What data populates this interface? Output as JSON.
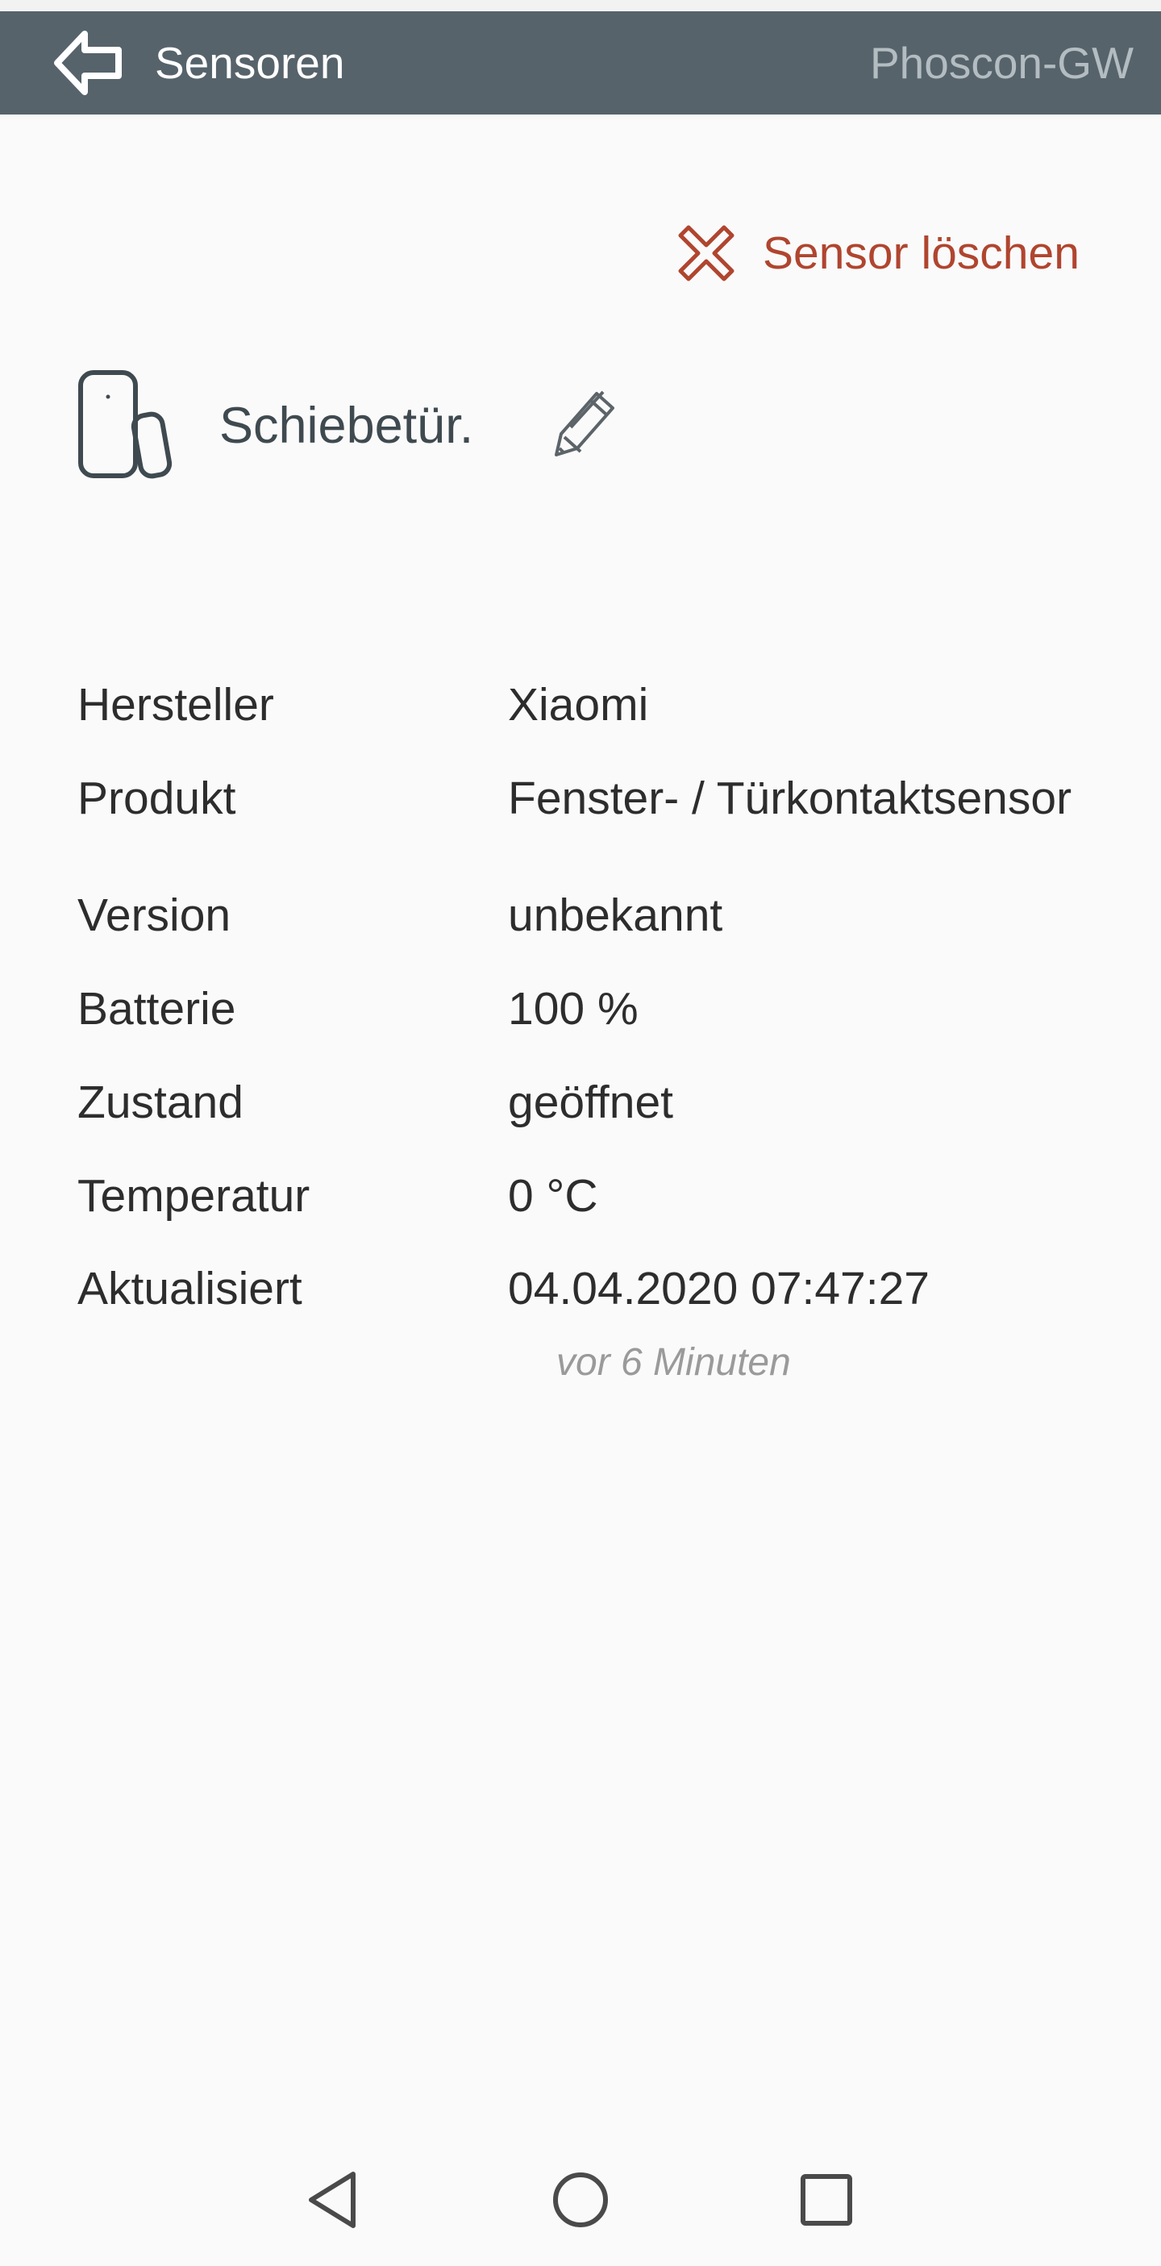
{
  "app_bar": {
    "title": "Sensoren",
    "gateway": "Phoscon-GW",
    "back_icon": "arrow-left-icon",
    "background": "#56636b"
  },
  "actions": {
    "delete_label": "Sensor löschen",
    "delete_icon": "x-circle-icon",
    "delete_color": "#b0452f"
  },
  "sensor": {
    "name": "Schiebetür.",
    "icon": "door-window-sensor-icon",
    "edit_icon": "pencil-icon"
  },
  "details": [
    {
      "label": "Hersteller",
      "value": "Xiaomi"
    },
    {
      "label": "Produkt",
      "value": "Fenster- / Türkontaktsensor"
    },
    {
      "label": "Version",
      "value": "unbekannt"
    },
    {
      "label": "Batterie",
      "value": "100 %"
    },
    {
      "label": "Zustand",
      "value": "geöffnet"
    },
    {
      "label": "Temperatur",
      "value": "0 °C"
    },
    {
      "label": "Aktualisiert",
      "value": "04.04.2020 07:47:27"
    }
  ],
  "updated_relative": "vor 6 Minuten",
  "nav": {
    "back_icon": "triangle-back-icon",
    "home_icon": "circle-home-icon",
    "recents_icon": "square-recents-icon"
  }
}
